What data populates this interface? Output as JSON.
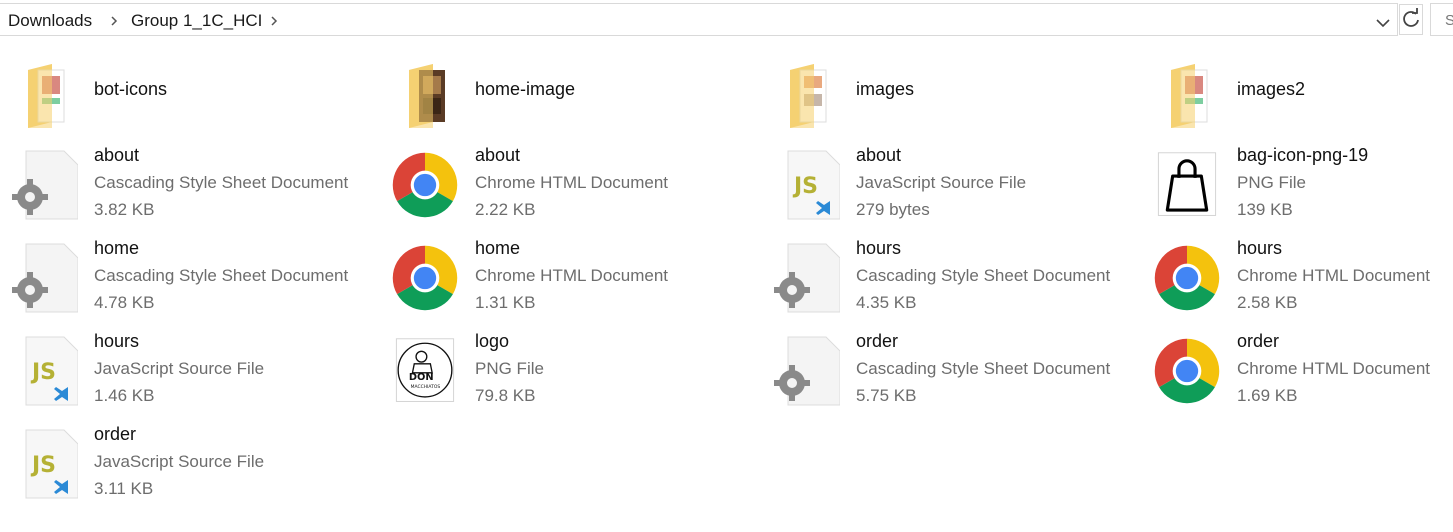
{
  "breadcrumb": {
    "items": [
      "Downloads",
      "Group 1_1C_HCI"
    ]
  },
  "search": {
    "placeholder_visible": "S"
  },
  "folders": [
    {
      "name": "bot-icons"
    },
    {
      "name": "home-image"
    },
    {
      "name": "images"
    },
    {
      "name": "images2"
    }
  ],
  "files": [
    {
      "name": "about",
      "type": "Cascading Style Sheet Document",
      "size": "3.82 KB",
      "icon": "css-gear-icon"
    },
    {
      "name": "about",
      "type": "Chrome HTML Document",
      "size": "2.22 KB",
      "icon": "chrome-icon"
    },
    {
      "name": "about",
      "type": "JavaScript Source File",
      "size": "279 bytes",
      "icon": "js-file-icon"
    },
    {
      "name": "bag-icon-png-19",
      "type": "PNG File",
      "size": "139 KB",
      "icon": "bag-thumbnail-icon"
    },
    {
      "name": "home",
      "type": "Cascading Style Sheet Document",
      "size": "4.78 KB",
      "icon": "css-gear-icon"
    },
    {
      "name": "home",
      "type": "Chrome HTML Document",
      "size": "1.31 KB",
      "icon": "chrome-icon"
    },
    {
      "name": "hours",
      "type": "Cascading Style Sheet Document",
      "size": "4.35 KB",
      "icon": "css-gear-icon"
    },
    {
      "name": "hours",
      "type": "Chrome HTML Document",
      "size": "2.58 KB",
      "icon": "chrome-icon"
    },
    {
      "name": "hours",
      "type": "JavaScript Source File",
      "size": "1.46 KB",
      "icon": "js-file-icon"
    },
    {
      "name": "logo",
      "type": "PNG File",
      "size": "79.8 KB",
      "icon": "logo-thumbnail-icon",
      "thumb_text": "DON",
      "thumb_sub": "MACCHIATOS"
    },
    {
      "name": "order",
      "type": "Cascading Style Sheet Document",
      "size": "5.75 KB",
      "icon": "css-gear-icon"
    },
    {
      "name": "order",
      "type": "Chrome HTML Document",
      "size": "1.69 KB",
      "icon": "chrome-icon"
    },
    {
      "name": "order",
      "type": "JavaScript Source File",
      "size": "3.11 KB",
      "icon": "js-file-icon"
    }
  ],
  "icon_labels": {
    "js": "JS"
  },
  "colors": {
    "folder": "#f5cf6b",
    "js_text": "#b5b135",
    "vscode_blue": "#2b8ad6",
    "chrome_red": "#db4437",
    "chrome_yellow": "#f4c20d",
    "chrome_green": "#0f9d58",
    "chrome_blue": "#4285f4"
  }
}
